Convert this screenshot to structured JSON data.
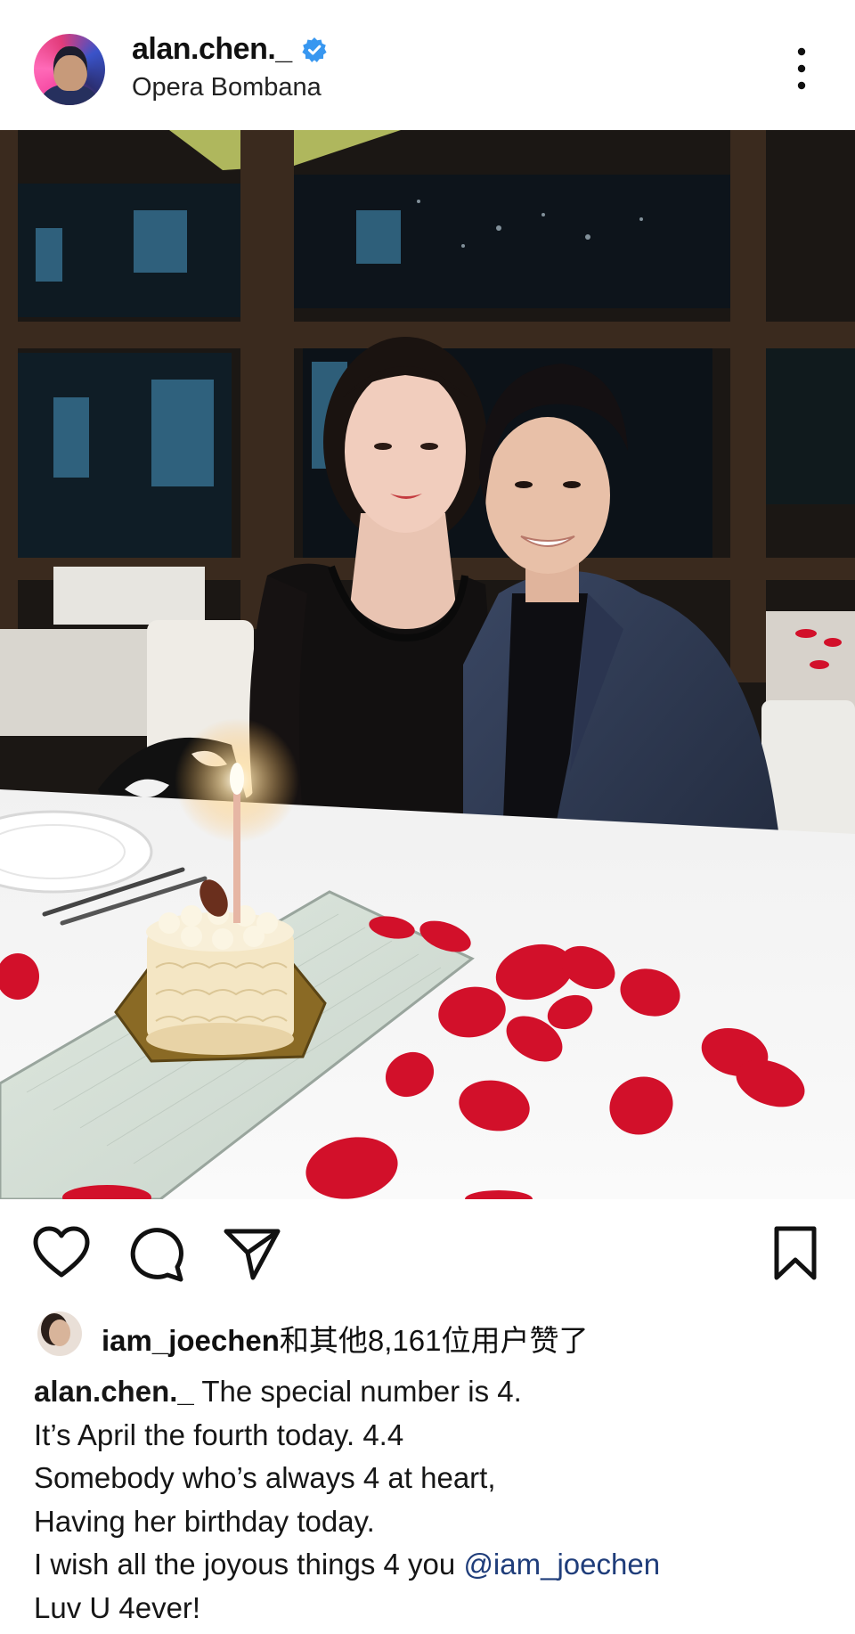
{
  "header": {
    "username": "alan.chen._",
    "location": "Opera Bombana",
    "avatar_icon": "profile-avatar",
    "verified_icon": "verified-badge-icon",
    "more_icon": "more-vertical-icon"
  },
  "photo": {
    "candle_icon": "birthday-candle",
    "cake_icon": "birthday-cake"
  },
  "actions": {
    "like_icon": "heart-icon",
    "comment_icon": "comment-bubble-icon",
    "share_icon": "paper-plane-icon",
    "save_icon": "bookmark-icon"
  },
  "likes": {
    "username": "iam_joechen",
    "suffix": "和其他8,161位用户赞了"
  },
  "caption": {
    "username": "alan.chen._",
    "lines": [
      " The special number is 4.",
      "It’s April the fourth today. 4.4",
      "Somebody who’s always 4 at heart,",
      "Having her birthday today.",
      "I wish all the joyous things 4 you ",
      "Luv U 4ever!"
    ],
    "mention": "@iam_joechen"
  },
  "colors": {
    "verified_blue": "#3897f0",
    "text": "#111111",
    "mention": "#1f3d7a",
    "rose_petal": "#d2102a"
  }
}
